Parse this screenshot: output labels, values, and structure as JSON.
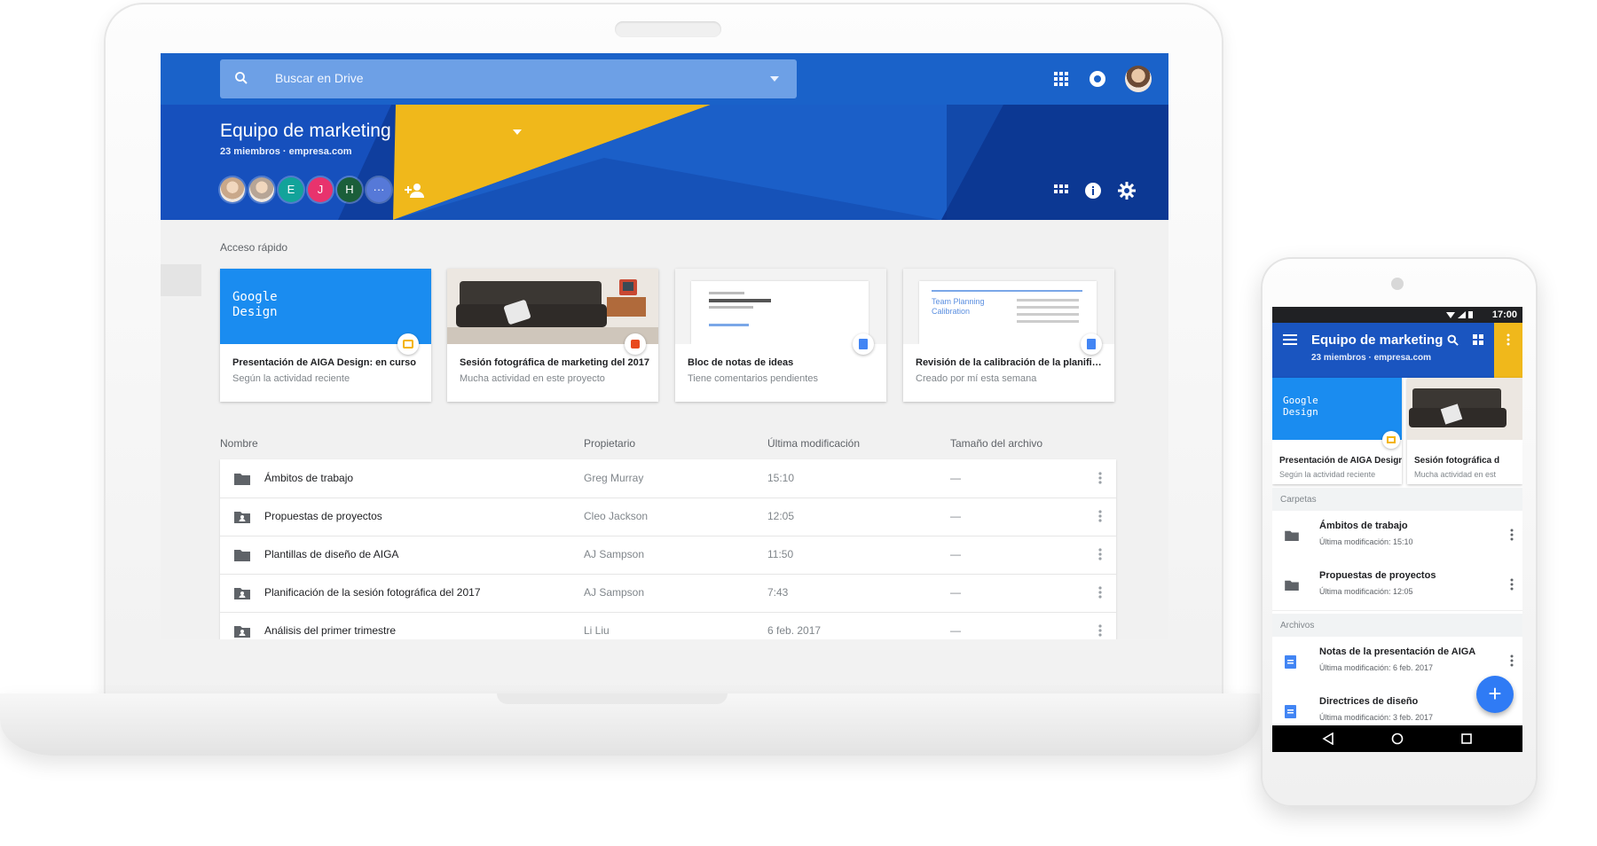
{
  "drive": {
    "search": {
      "placeholder": "Buscar en Drive"
    },
    "team": {
      "title": "Equipo de marketing",
      "subtitle": "23 miembros · empresa.com",
      "members": [
        {
          "initial": "",
          "color": "#c9a88a"
        },
        {
          "initial": "",
          "color": "#b7a596"
        },
        {
          "initial": "E",
          "color": "#12a39a"
        },
        {
          "initial": "J",
          "color": "#e8336d"
        },
        {
          "initial": "H",
          "color": "#1b5e3a"
        },
        {
          "initial": "···",
          "color": "#5679d8"
        }
      ]
    },
    "quick_access": {
      "label": "Acceso rápido",
      "cards": [
        {
          "title": "Presentación de AIGA Design: en curso",
          "subtitle": "Según la actividad reciente",
          "thumb_text": "Google\nDesign",
          "badge_color": "#f4b400",
          "icon": "slides-icon"
        },
        {
          "title": "Sesión fotográfica de marketing del 2017",
          "subtitle": "Mucha actividad en este proyecto",
          "badge_color": "#e8491d",
          "icon": "image-icon"
        },
        {
          "title": "Bloc de notas de ideas",
          "subtitle": "Tiene comentarios pendientes",
          "badge_color": "#4285f4",
          "icon": "docs-icon"
        },
        {
          "title": "Revisión de la calibración de la planificación",
          "subtitle": "Creado por mí esta semana",
          "thumb_text": "Team Planning\nCalibration",
          "badge_color": "#4285f4",
          "icon": "docs-icon"
        }
      ]
    },
    "table": {
      "headers": {
        "name": "Nombre",
        "owner": "Propietario",
        "modified": "Última modificación",
        "size": "Tamaño del archivo"
      },
      "rows": [
        {
          "name": "Ámbitos de trabajo",
          "owner": "Greg Murray",
          "modified": "15:10",
          "size": "—",
          "icon": "folder-icon"
        },
        {
          "name": "Propuestas de proyectos",
          "owner": "Cleo Jackson",
          "modified": "12:05",
          "size": "—",
          "icon": "shared-folder-icon"
        },
        {
          "name": "Plantillas de diseño de AIGA",
          "owner": "AJ Sampson",
          "modified": "11:50",
          "size": "—",
          "icon": "folder-icon"
        },
        {
          "name": "Planificación de la sesión fotográfica del 2017",
          "owner": "AJ Sampson",
          "modified": "7:43",
          "size": "—",
          "icon": "shared-folder-icon"
        },
        {
          "name": "Análisis del primer trimestre",
          "owner": "Li Liu",
          "modified": "6 feb. 2017",
          "size": "—",
          "icon": "shared-folder-icon"
        }
      ]
    }
  },
  "phone": {
    "status_time": "17:00",
    "title": "Equipo de marketing",
    "subtitle": "23 miembros · empresa.com",
    "cards": [
      {
        "title": "Presentación de AIGA Design...",
        "subtitle": "Según la actividad reciente",
        "thumb_text": "Google\nDesign"
      },
      {
        "title": "Sesión fotográfica d",
        "subtitle": "Mucha actividad en est"
      }
    ],
    "folders_label": "Carpetas",
    "folders": [
      {
        "name": "Ámbitos de trabajo",
        "meta": "Última modificación: 15:10"
      },
      {
        "name": "Propuestas de proyectos",
        "meta": "Última modificación: 12:05"
      }
    ],
    "files_label": "Archivos",
    "files": [
      {
        "name": "Notas de la presentación de AIGA",
        "meta": "Última modificación: 6 feb. 2017"
      },
      {
        "name": "Directrices de diseño",
        "meta": "Última modificación: 3 feb. 2017"
      }
    ],
    "fab_label": "+"
  },
  "colors": {
    "accent": "#1a62c9",
    "banner_dark": "#0f3e9e",
    "banner_yellow": "#f0b81b",
    "fab": "#2f7bf5"
  }
}
